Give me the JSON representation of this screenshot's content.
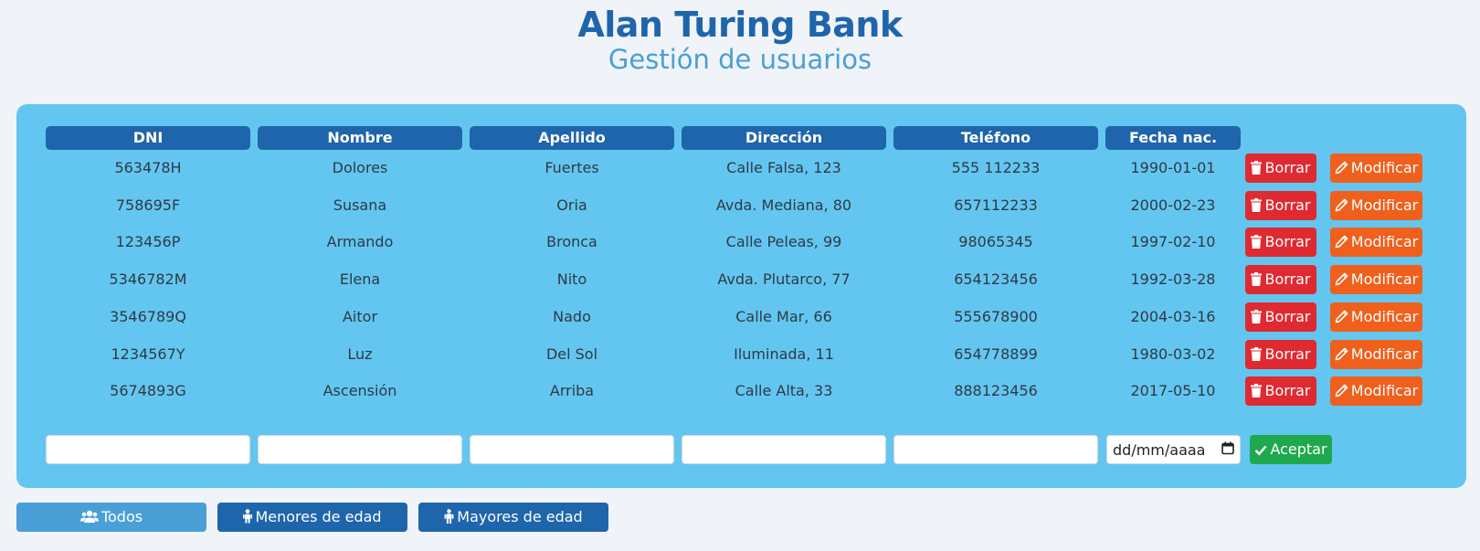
{
  "header": {
    "title": "Alan Turing Bank",
    "subtitle": "Gestión de usuarios"
  },
  "table": {
    "columns": [
      "DNI",
      "Nombre",
      "Apellido",
      "Dirección",
      "Teléfono",
      "Fecha nac."
    ],
    "rows": [
      {
        "dni": "563478H",
        "nombre": "Dolores",
        "apellido": "Fuertes",
        "direccion": "Calle Falsa, 123",
        "telefono": "555 112233",
        "fecha": "1990-01-01"
      },
      {
        "dni": "758695F",
        "nombre": "Susana",
        "apellido": "Oria",
        "direccion": "Avda. Mediana, 80",
        "telefono": "657112233",
        "fecha": "2000-02-23"
      },
      {
        "dni": "123456P",
        "nombre": "Armando",
        "apellido": "Bronca",
        "direccion": "Calle Peleas, 99",
        "telefono": "98065345",
        "fecha": "1997-02-10"
      },
      {
        "dni": "5346782M",
        "nombre": "Elena",
        "apellido": "Nito",
        "direccion": "Avda. Plutarco, 77",
        "telefono": "654123456",
        "fecha": "1992-03-28"
      },
      {
        "dni": "3546789Q",
        "nombre": "Aitor",
        "apellido": "Nado",
        "direccion": "Calle Mar, 66",
        "telefono": "555678900",
        "fecha": "2004-03-16"
      },
      {
        "dni": "1234567Y",
        "nombre": "Luz",
        "apellido": "Del Sol",
        "direccion": "Iluminada, 11",
        "telefono": "654778899",
        "fecha": "1980-03-02"
      },
      {
        "dni": "5674893G",
        "nombre": "Ascensión",
        "apellido": "Arriba",
        "direccion": "Calle Alta, 33",
        "telefono": "888123456",
        "fecha": "2017-05-10"
      }
    ],
    "delete_label": "Borrar",
    "modify_label": "Modificar"
  },
  "form": {
    "date_placeholder": "dd/mm/aaaa",
    "accept_label": "Aceptar"
  },
  "filters": [
    {
      "label": "Todos",
      "icon": "users-icon",
      "active": true
    },
    {
      "label": "Menores de edad",
      "icon": "child-icon",
      "active": false
    },
    {
      "label": "Mayores de edad",
      "icon": "person-icon",
      "active": false
    }
  ],
  "colors": {
    "primary": "#1f65ab",
    "panel": "#63c6f0",
    "delete": "#df2a31",
    "modify": "#f0601d",
    "accept": "#1fa94e"
  }
}
